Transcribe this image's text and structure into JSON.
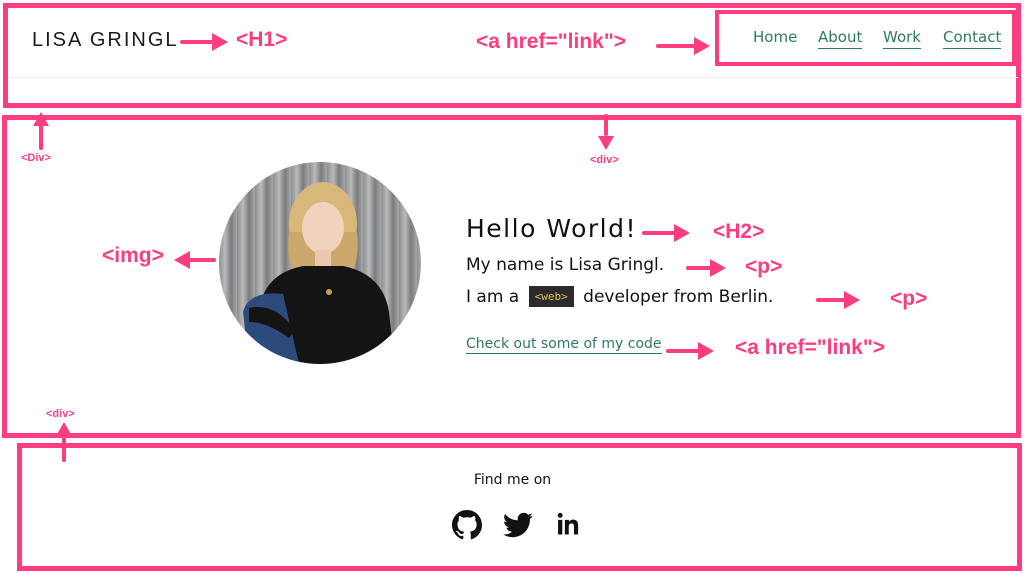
{
  "header": {
    "title": "LISA GRINGL",
    "nav": [
      {
        "label": "Home"
      },
      {
        "label": "About"
      },
      {
        "label": "Work"
      },
      {
        "label": "Contact"
      }
    ]
  },
  "hero": {
    "heading": "Hello World!",
    "intro": "My name is Lisa Gringl.",
    "tagline_before": "I am a",
    "code_chip": "<web>",
    "tagline_after": "developer from Berlin.",
    "link_label": "Check out some of my code"
  },
  "footer": {
    "find_me": "Find me on",
    "social": [
      {
        "icon": "github-icon"
      },
      {
        "icon": "twitter-icon"
      },
      {
        "icon": "linkedin-icon"
      }
    ]
  },
  "annotations": {
    "h1": "<H1>",
    "a_link_nav": "<a href=\"link\">",
    "div_left": "<Div>",
    "div_mid": "<div>",
    "img": "<img>",
    "h2": "<H2>",
    "p1": "<p>",
    "p2": "<p>",
    "a_link_hero": "<a href=\"link\">",
    "div_bottom": "<div>"
  },
  "colors": {
    "annotation": "#ff3d7f",
    "link": "#2f7a5c",
    "chip_bg": "#2b2b2b",
    "chip_text": "#e0c060"
  }
}
